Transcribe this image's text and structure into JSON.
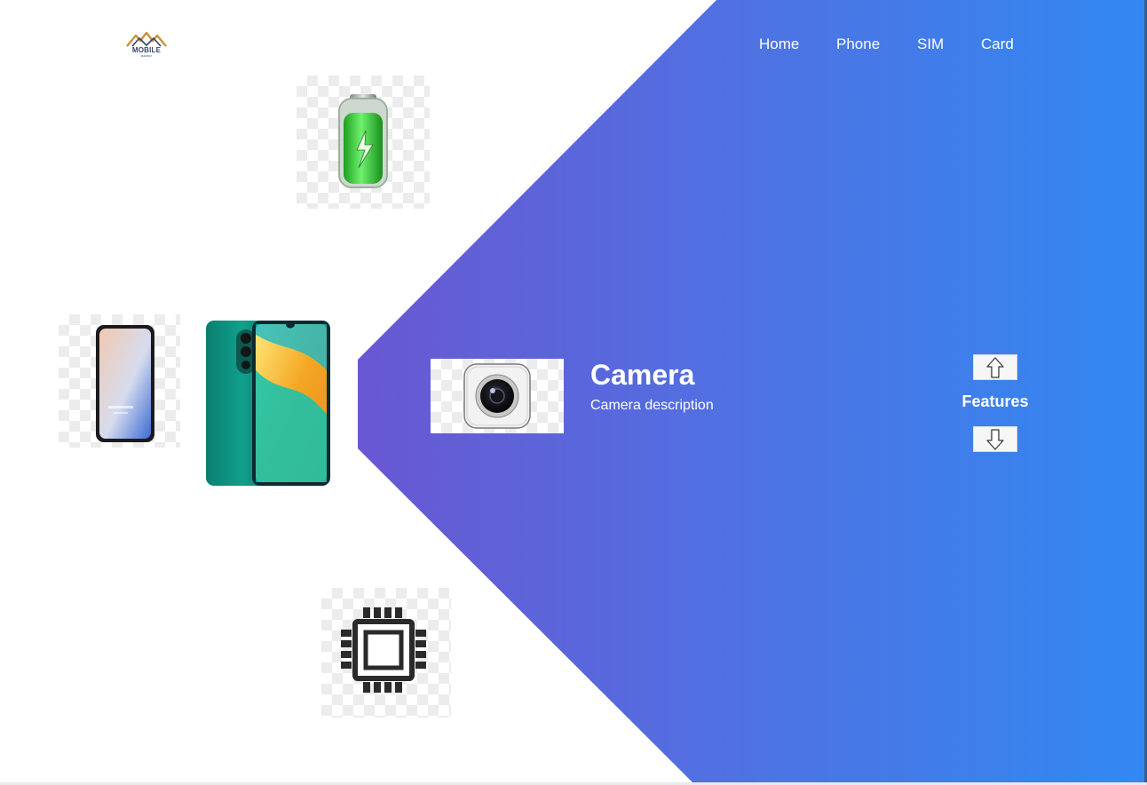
{
  "brand": {
    "logo_name": "MOBILE",
    "logo_subtext": "MARKET"
  },
  "nav": {
    "items": [
      {
        "label": "Home"
      },
      {
        "label": "Phone"
      },
      {
        "label": "SIM"
      },
      {
        "label": "Card"
      }
    ]
  },
  "gallery": {
    "items": [
      {
        "icon": "battery-icon"
      },
      {
        "icon": "phone-front-icon"
      },
      {
        "icon": "phone-color-icon"
      },
      {
        "icon": "processor-chip-icon"
      }
    ]
  },
  "feature": {
    "icon": "camera-icon",
    "title": "Camera",
    "description": "Camera description"
  },
  "features_control": {
    "label": "Features",
    "up_icon": "arrow-up-icon",
    "down_icon": "arrow-down-icon"
  },
  "colors": {
    "gradient_start": "#8048c8",
    "gradient_end": "#3288f2",
    "text_on_gradient": "#ffffff"
  }
}
